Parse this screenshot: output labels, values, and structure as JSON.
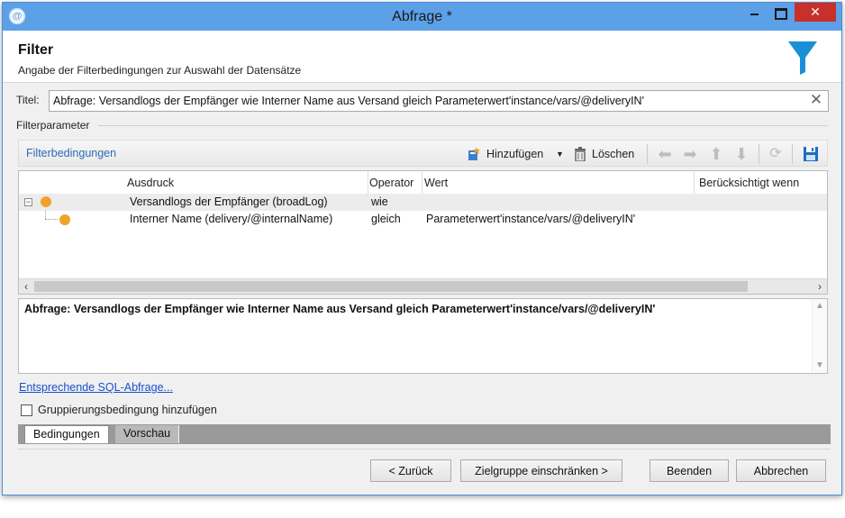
{
  "window": {
    "title": "Abfrage *",
    "close_glyph": "✕"
  },
  "header": {
    "title": "Filter",
    "subtitle": "Angabe der Filterbedingungen zur Auswahl der Datensätze",
    "icon": "funnel-icon"
  },
  "title_field": {
    "label": "Titel:",
    "value": "Abfrage: Versandlogs der Empfänger wie Interner Name aus Versand gleich Parameterwert'instance/vars/@deliveryIN'"
  },
  "filterparameter": {
    "label": "Filterparameter"
  },
  "toolbar": {
    "section_label": "Filterbedingungen",
    "add_label": "Hinzufügen",
    "delete_label": "Löschen"
  },
  "grid": {
    "columns": [
      "Ausdruck",
      "Operator",
      "Wert",
      "Berücksichtigt wenn"
    ],
    "rows": [
      {
        "expression": "Versandlogs der Empfänger (broadLog)",
        "operator": "wie",
        "value": ""
      },
      {
        "expression": "Interner Name (delivery/@internalName)",
        "operator": "gleich",
        "value": "Parameterwert'instance/vars/@deliveryIN'"
      }
    ]
  },
  "summary": {
    "text": "Abfrage: Versandlogs der Empfänger wie Interner Name aus Versand gleich  Parameterwert'instance/vars/@deliveryIN'"
  },
  "links": {
    "sql": "Entsprechende SQL-Abfrage..."
  },
  "grouping": {
    "label": "Gruppierungsbedingung hinzufügen",
    "checked": false
  },
  "tabs": [
    {
      "label": "Bedingungen",
      "active": true
    },
    {
      "label": "Vorschau",
      "active": false
    }
  ],
  "buttons": {
    "back": "< Zurück",
    "restrict": "Zielgruppe einschränken >",
    "finish": "Beenden",
    "cancel": "Abbrechen"
  },
  "colors": {
    "titlebar": "#5ca0e8",
    "close": "#c7302b",
    "accent": "#1a8fd6",
    "dot": "#f0a32b"
  }
}
